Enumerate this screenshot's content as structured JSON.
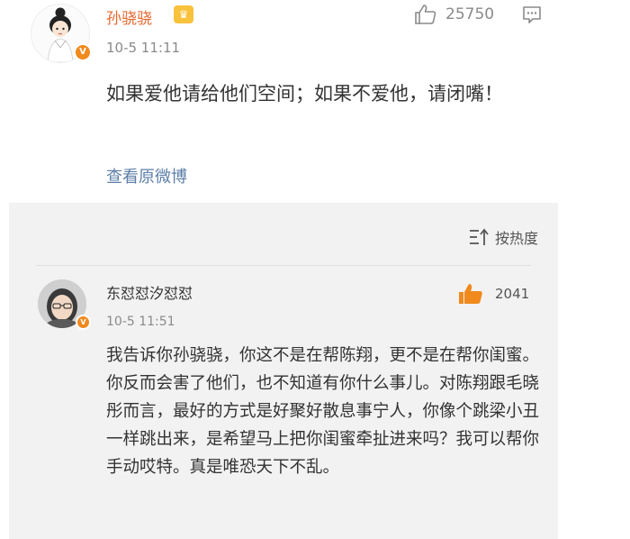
{
  "post": {
    "author_name": "孙骁骁",
    "time": "10-5 11:11",
    "like_count": "25750",
    "text": "如果爱他请给他们空间；如果不爱他，请闭嘴！",
    "view_original_label": "查看原微博",
    "icons": {
      "avatar": "avatar-cartoon-girl",
      "verified": "verified-v-badge",
      "member": "crown-badge-icon",
      "like": "thumbs-up-icon",
      "comment": "comment-bubble-icon"
    }
  },
  "sort": {
    "label": "按热度",
    "icon": "sort-hot-icon"
  },
  "comment": {
    "author_name": "东怼怼汐怼怼",
    "time": "10-5 11:51",
    "like_count": "2041",
    "text": "我告诉你孙骁骁，你这不是在帮陈翔，更不是在帮你闺蜜。你反而会害了他们，也不知道有你什么事儿。对陈翔跟毛晓彤而言，最好的方式是好聚好散息事宁人，你像个跳梁小丑一样跳出来，是希望马上把你闺蜜牵扯进来吗？我可以帮你手动哎特。真是唯恐天下不乱。",
    "icons": {
      "avatar": "avatar-photo",
      "verified": "verified-v-badge",
      "like": "thumbs-up-icon"
    }
  },
  "colors": {
    "author_name": "#e8682e",
    "link": "#5d7fa8",
    "like_active": "#f08a1d",
    "panel_background": "#f2f2f2",
    "verified_badge": "#f08a1d"
  }
}
